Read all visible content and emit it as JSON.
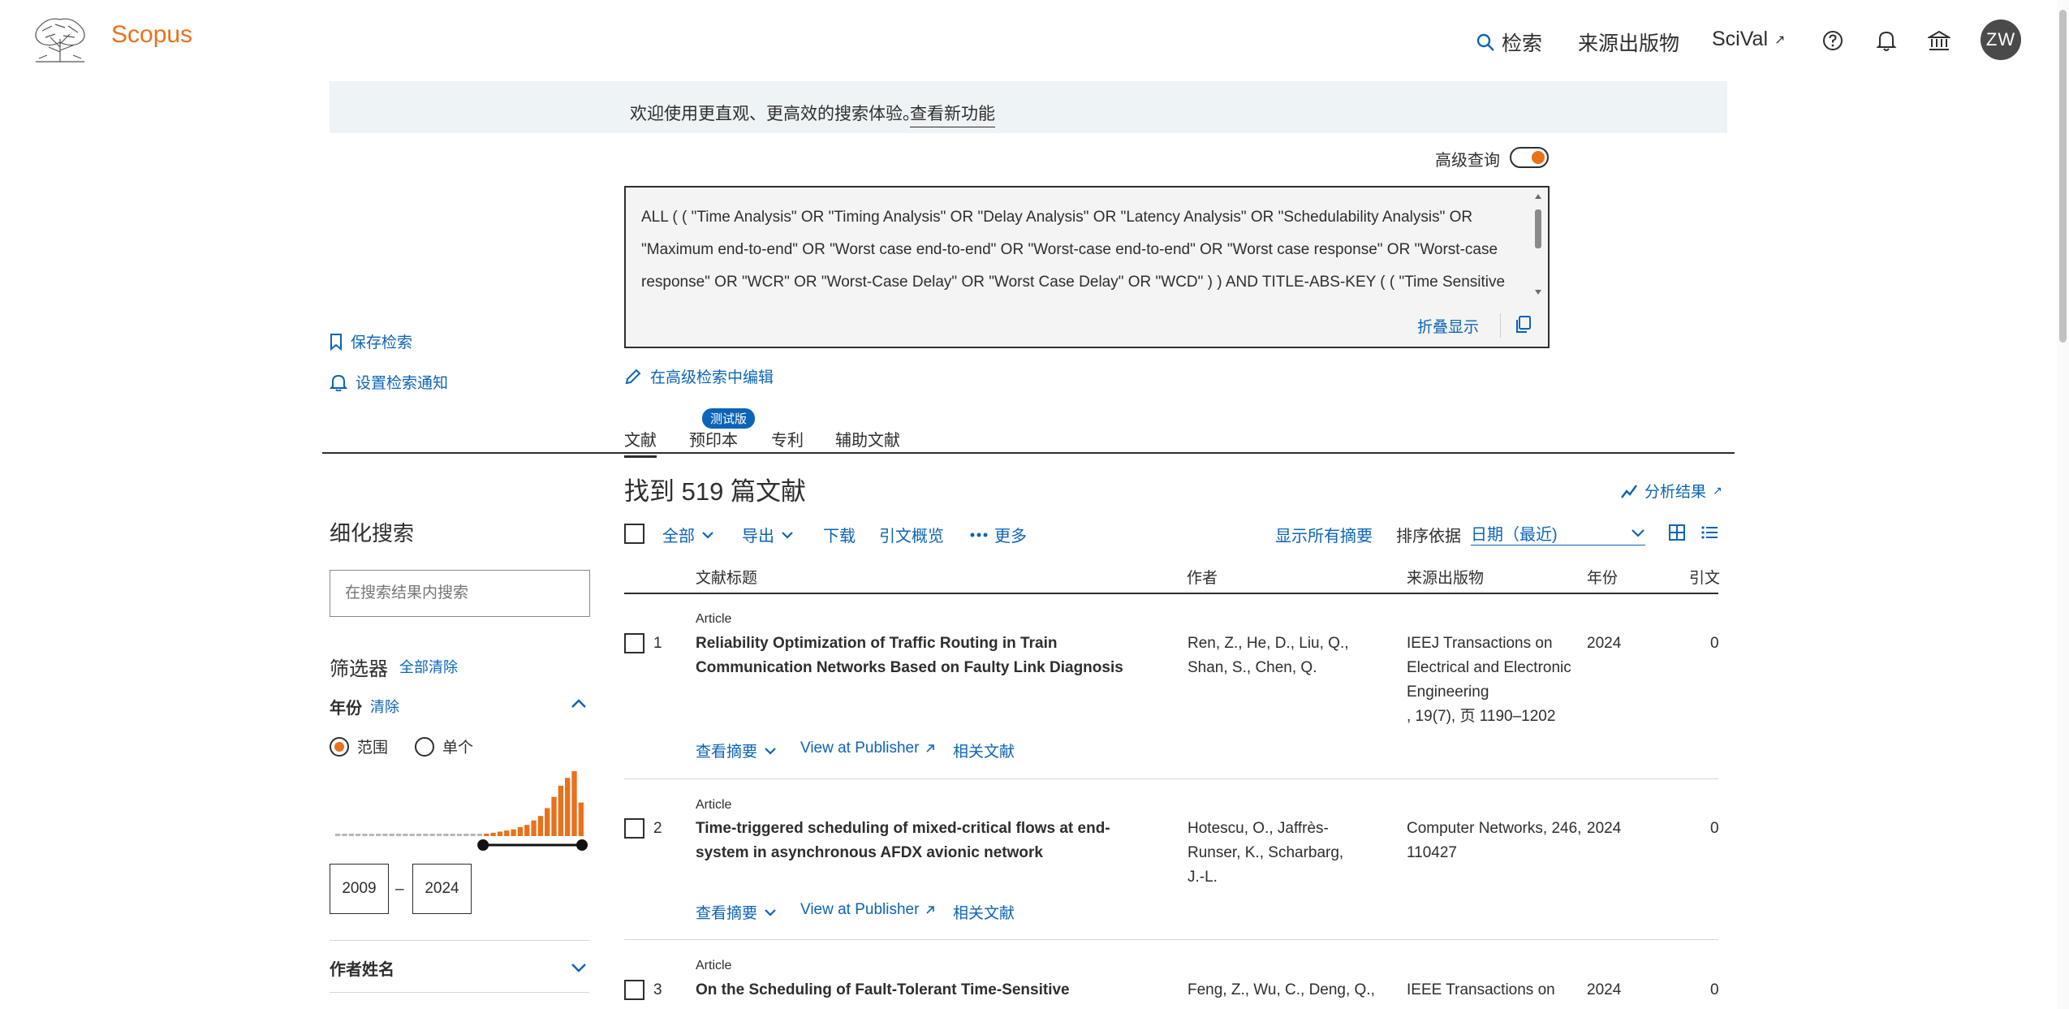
{
  "header": {
    "brand": "Scopus",
    "nav": {
      "search": "检索",
      "sources": "来源出版物",
      "scival": "SciVal",
      "scival_ext": "↗"
    },
    "avatar": "ZW"
  },
  "banner": {
    "text": "欢迎使用更直观、更高效的搜索体验。",
    "link": "查看新功能"
  },
  "query": {
    "toggle_label": "高级查询",
    "text": "ALL ( ( \"Time Analysis\" OR \"Timing Analysis\" OR \"Delay Analysis\" OR \"Latency Analysis\" OR \"Schedulability Analysis\" OR \"Maximum end-to-end\" OR \"Worst case end-to-end\" OR \"Worst-case end-to-end\" OR \"Worst case response\" OR \"Worst-case response\" OR \"WCR\" OR \"Worst-Case Delay\" OR \"Worst Case Delay\" OR \"WCD\" ) ) AND TITLE-ABS-KEY ( ( \"Time Sensitive Network*\" OR \"Time-",
    "collapse": "折叠显示",
    "edit_advanced": "在高级检索中编辑"
  },
  "left_actions": {
    "save": "保存检索",
    "alert": "设置检索通知"
  },
  "tabs": {
    "documents": "文献",
    "preprints": "预印本",
    "beta": "测试版",
    "patents": "专利",
    "secondary": "辅助文献"
  },
  "results": {
    "count_text": "找到 519 篇文献",
    "analyze": "分析结果",
    "analyze_ext": "↗"
  },
  "refine": {
    "title": "细化搜索",
    "placeholder": "在搜索结果内搜索",
    "filters": "筛选器",
    "clear_all": "全部清除",
    "year": "年份",
    "year_clear": "清除",
    "range": "范围",
    "single": "单个",
    "year_from": "2009",
    "year_to": "2024",
    "dash": "–",
    "author": "作者姓名",
    "histogram_values": [
      1,
      1,
      1,
      1,
      1,
      1,
      1,
      1,
      1,
      1,
      1,
      1,
      1,
      1,
      1,
      1,
      1,
      1,
      1,
      1,
      1,
      1,
      2,
      3,
      4,
      5,
      6,
      8,
      10,
      14,
      18,
      25,
      35,
      45,
      52,
      58,
      30
    ]
  },
  "toolbar": {
    "all": "全部",
    "export": "导出",
    "download": "下载",
    "citation_overview": "引文概览",
    "more": "更多",
    "show_abstracts": "显示所有摘要",
    "sort_label": "排序依据",
    "sort_value": "日期（最近)"
  },
  "columns": {
    "title": "文献标题",
    "authors": "作者",
    "source": "来源出版物",
    "year": "年份",
    "cited": "引文"
  },
  "documents": [
    {
      "num": "1",
      "type": "Article",
      "title": "Reliability Optimization of Traffic Routing in Train Communication Networks Based on Faulty Link Diagnosis",
      "authors": "Ren, Z., He, D., Liu, Q., Shan, S., Chen, Q.",
      "source": "IEEJ Transactions on Electrical and Electronic Engineering",
      "source_detail": ", 19(7), 页 1190–1202",
      "year": "2024",
      "cited": "0",
      "abstract": "查看摘要",
      "publisher": "View at Publisher",
      "related": "相关文献"
    },
    {
      "num": "2",
      "type": "Article",
      "title": "Time-triggered scheduling of mixed-critical flows at end-system in asynchronous AFDX avionic network",
      "authors": "Hotescu, O., Jaffrès-Runser, K., Scharbarg, J.-L.",
      "source": "Computer Networks, 246, 110427",
      "source_detail": "",
      "year": "2024",
      "cited": "0",
      "abstract": "查看摘要",
      "publisher": "View at Publisher",
      "related": "相关文献"
    },
    {
      "num": "3",
      "type": "Article",
      "title": "On the Scheduling of Fault-Tolerant Time-Sensitive Networking",
      "authors": "Feng, Z., Wu, C., Deng, Q.,",
      "source": "IEEE Transactions on",
      "source_detail": "",
      "year": "2024",
      "cited": "0"
    }
  ]
}
